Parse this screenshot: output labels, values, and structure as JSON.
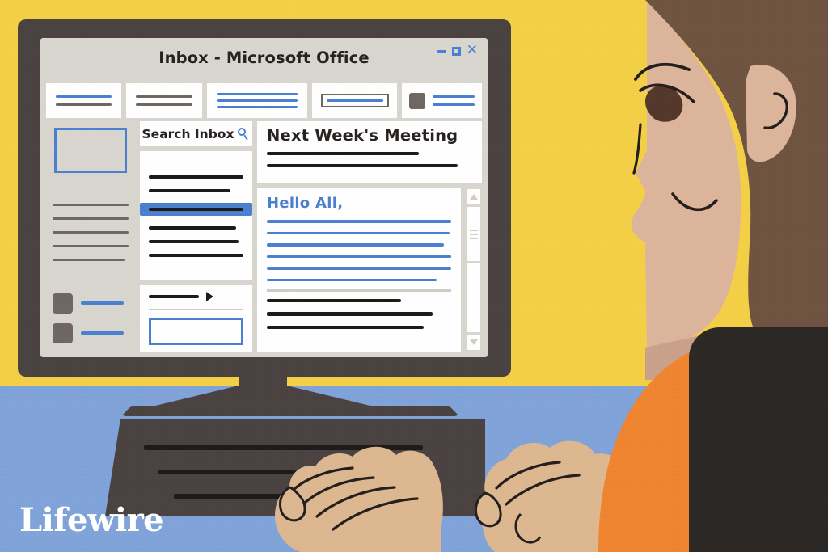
{
  "scene": {
    "brand": "Lifewire",
    "colors": {
      "background_top": "#f3cf46",
      "background_bottom": "#7fa2d8",
      "monitor_frame": "#4a4240",
      "screen_chrome": "#d8d5cf",
      "panel_white": "#fefefe",
      "accent_blue": "#4a7fd0",
      "ink_dark": "#1d1a19",
      "ink_grey": "#6e6662",
      "skin": "#d8b28c",
      "skin_face": "#dcb49a",
      "hair": "#6e5340",
      "shirt": "#ef8330",
      "chair": "#2b2825"
    }
  },
  "window": {
    "title": "Inbox - Microsoft Office",
    "controls": [
      {
        "name": "minimize",
        "glyph": "minimize-icon"
      },
      {
        "name": "maximize",
        "glyph": "maximize-icon"
      },
      {
        "name": "close",
        "glyph": "close-icon"
      }
    ]
  },
  "ribbon": {
    "cards": [
      {
        "id": "card-1",
        "lines": [
          "blue",
          "grey"
        ]
      },
      {
        "id": "card-2",
        "lines": [
          "grey",
          "grey"
        ]
      },
      {
        "id": "card-3",
        "lines": [
          "blue",
          "blue",
          "blue"
        ]
      },
      {
        "id": "card-4",
        "type": "outlined-field"
      },
      {
        "id": "card-5",
        "type": "icon-with-lines"
      }
    ]
  },
  "sidebar": {
    "folder_preview": {
      "label": "folder-preview-box"
    },
    "folder_lines": 5,
    "accounts": [
      {
        "id": "account-1"
      },
      {
        "id": "account-2"
      }
    ]
  },
  "message_list": {
    "search": {
      "label": "Search Inbox",
      "icon": "search-icon"
    },
    "rows": [
      {
        "id": "row-1",
        "selected": false
      },
      {
        "id": "row-2",
        "selected": false
      },
      {
        "id": "row-3",
        "selected": true
      },
      {
        "id": "row-4",
        "selected": false
      },
      {
        "id": "row-5",
        "selected": false
      },
      {
        "id": "row-6",
        "selected": false
      }
    ],
    "compose": {
      "expander": "play-triangle-icon",
      "field": "compose-field"
    }
  },
  "reading_pane": {
    "subject": "Next Week's Meeting",
    "meta_lines": 2,
    "greeting": "Hello All,",
    "body_lines": 6,
    "signature_lines": 3,
    "scrollbar": {
      "up": "scroll-up-arrow-icon",
      "down": "scroll-down-arrow-icon",
      "thumb": "scrollbar-thumb"
    }
  },
  "keyboard": {
    "key_rows": 3
  },
  "person": {
    "features": [
      "eye",
      "eyebrow",
      "nose",
      "mouth",
      "ear",
      "hair"
    ],
    "hands": 2
  }
}
